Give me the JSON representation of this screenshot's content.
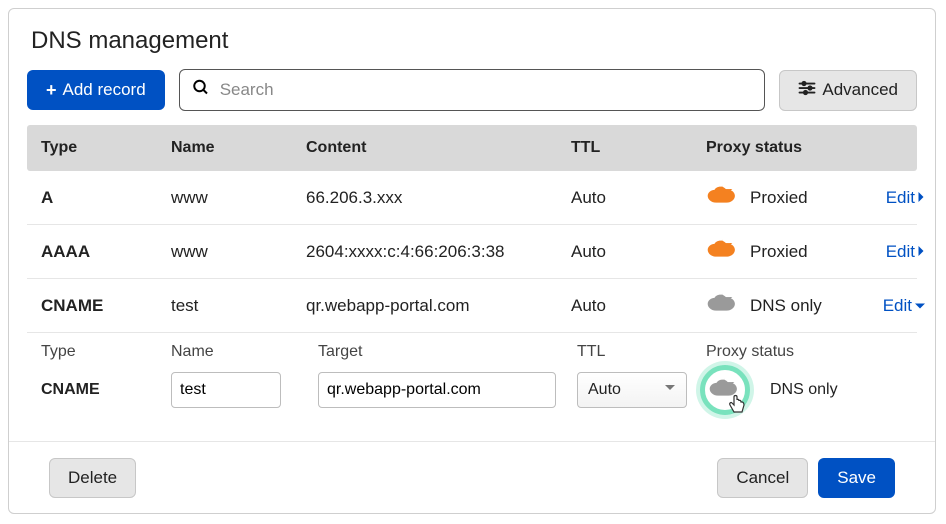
{
  "title": "DNS management",
  "toolbar": {
    "add_label": "Add record",
    "search_placeholder": "Search",
    "advanced_label": "Advanced"
  },
  "columns": {
    "type": "Type",
    "name": "Name",
    "content": "Content",
    "ttl": "TTL",
    "proxy": "Proxy status"
  },
  "rows": [
    {
      "type": "A",
      "name": "www",
      "content": "66.206.3.xxx",
      "ttl": "Auto",
      "proxy": "Proxied",
      "proxied": true,
      "action": "Edit",
      "action_icon": "chevron-right"
    },
    {
      "type": "AAAA",
      "name": "www",
      "content": "2604:xxxx:c:4:66:206:3:38",
      "ttl": "Auto",
      "proxy": "Proxied",
      "proxied": true,
      "action": "Edit",
      "action_icon": "chevron-right"
    },
    {
      "type": "CNAME",
      "name": "test",
      "content": "qr.webapp-portal.com",
      "ttl": "Auto",
      "proxy": "DNS only",
      "proxied": false,
      "action": "Edit",
      "action_icon": "chevron-down"
    }
  ],
  "edit": {
    "labels": {
      "type": "Type",
      "name": "Name",
      "target": "Target",
      "ttl": "TTL",
      "proxy": "Proxy status"
    },
    "values": {
      "type": "CNAME",
      "name": "test",
      "target": "qr.webapp-portal.com",
      "ttl": "Auto",
      "proxy": "DNS only",
      "proxied": false
    }
  },
  "footer": {
    "delete": "Delete",
    "cancel": "Cancel",
    "save": "Save"
  },
  "colors": {
    "primary": "#0051c3",
    "proxied": "#f48120",
    "dns_only": "#9a9a9a",
    "highlight": "#79e2bd"
  }
}
